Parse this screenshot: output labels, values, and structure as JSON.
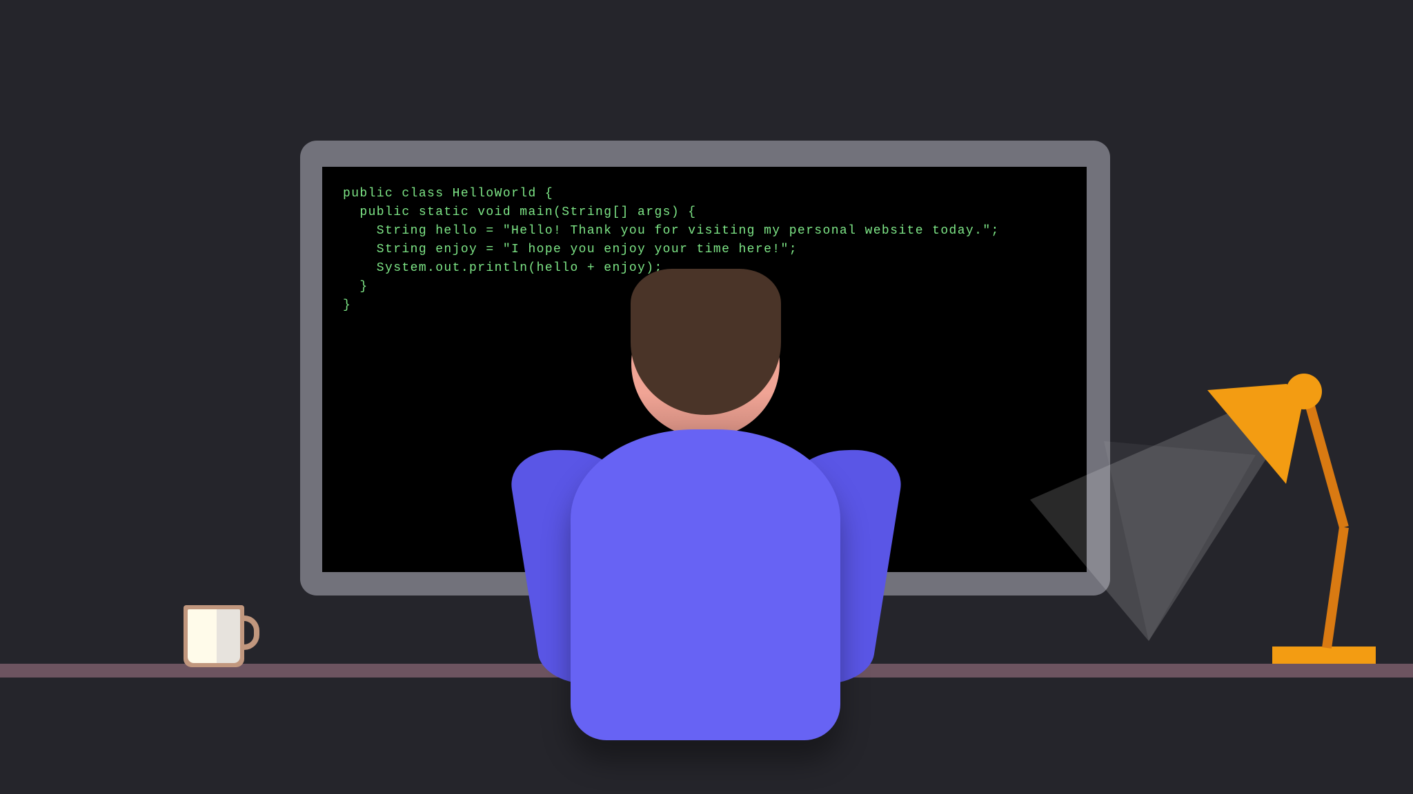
{
  "code": {
    "lines": [
      "public class HelloWorld {",
      "  public static void main(String[] args) {",
      "    String hello = \"Hello! Thank you for visiting my personal website today.\";",
      "    String enjoy = \"I hope you enjoy your time here!\";",
      "    System.out.println(hello + enjoy);",
      "  }",
      "}"
    ],
    "text_color": "#7ee787"
  },
  "colors": {
    "background": "#25252b",
    "monitor_frame": "#72727b",
    "screen": "#000000",
    "desk": "#6d5460",
    "shirt": "#6763f4",
    "hair": "#4a3428",
    "skin": "#f0a495",
    "lamp": "#f39c12",
    "lamp_arm": "#d97a12",
    "mug": "#c1977e",
    "mug_liquid": "#fffbea"
  },
  "icons": {
    "person": "person-back-view-icon",
    "mug": "coffee-mug-icon",
    "lamp": "desk-lamp-icon"
  }
}
